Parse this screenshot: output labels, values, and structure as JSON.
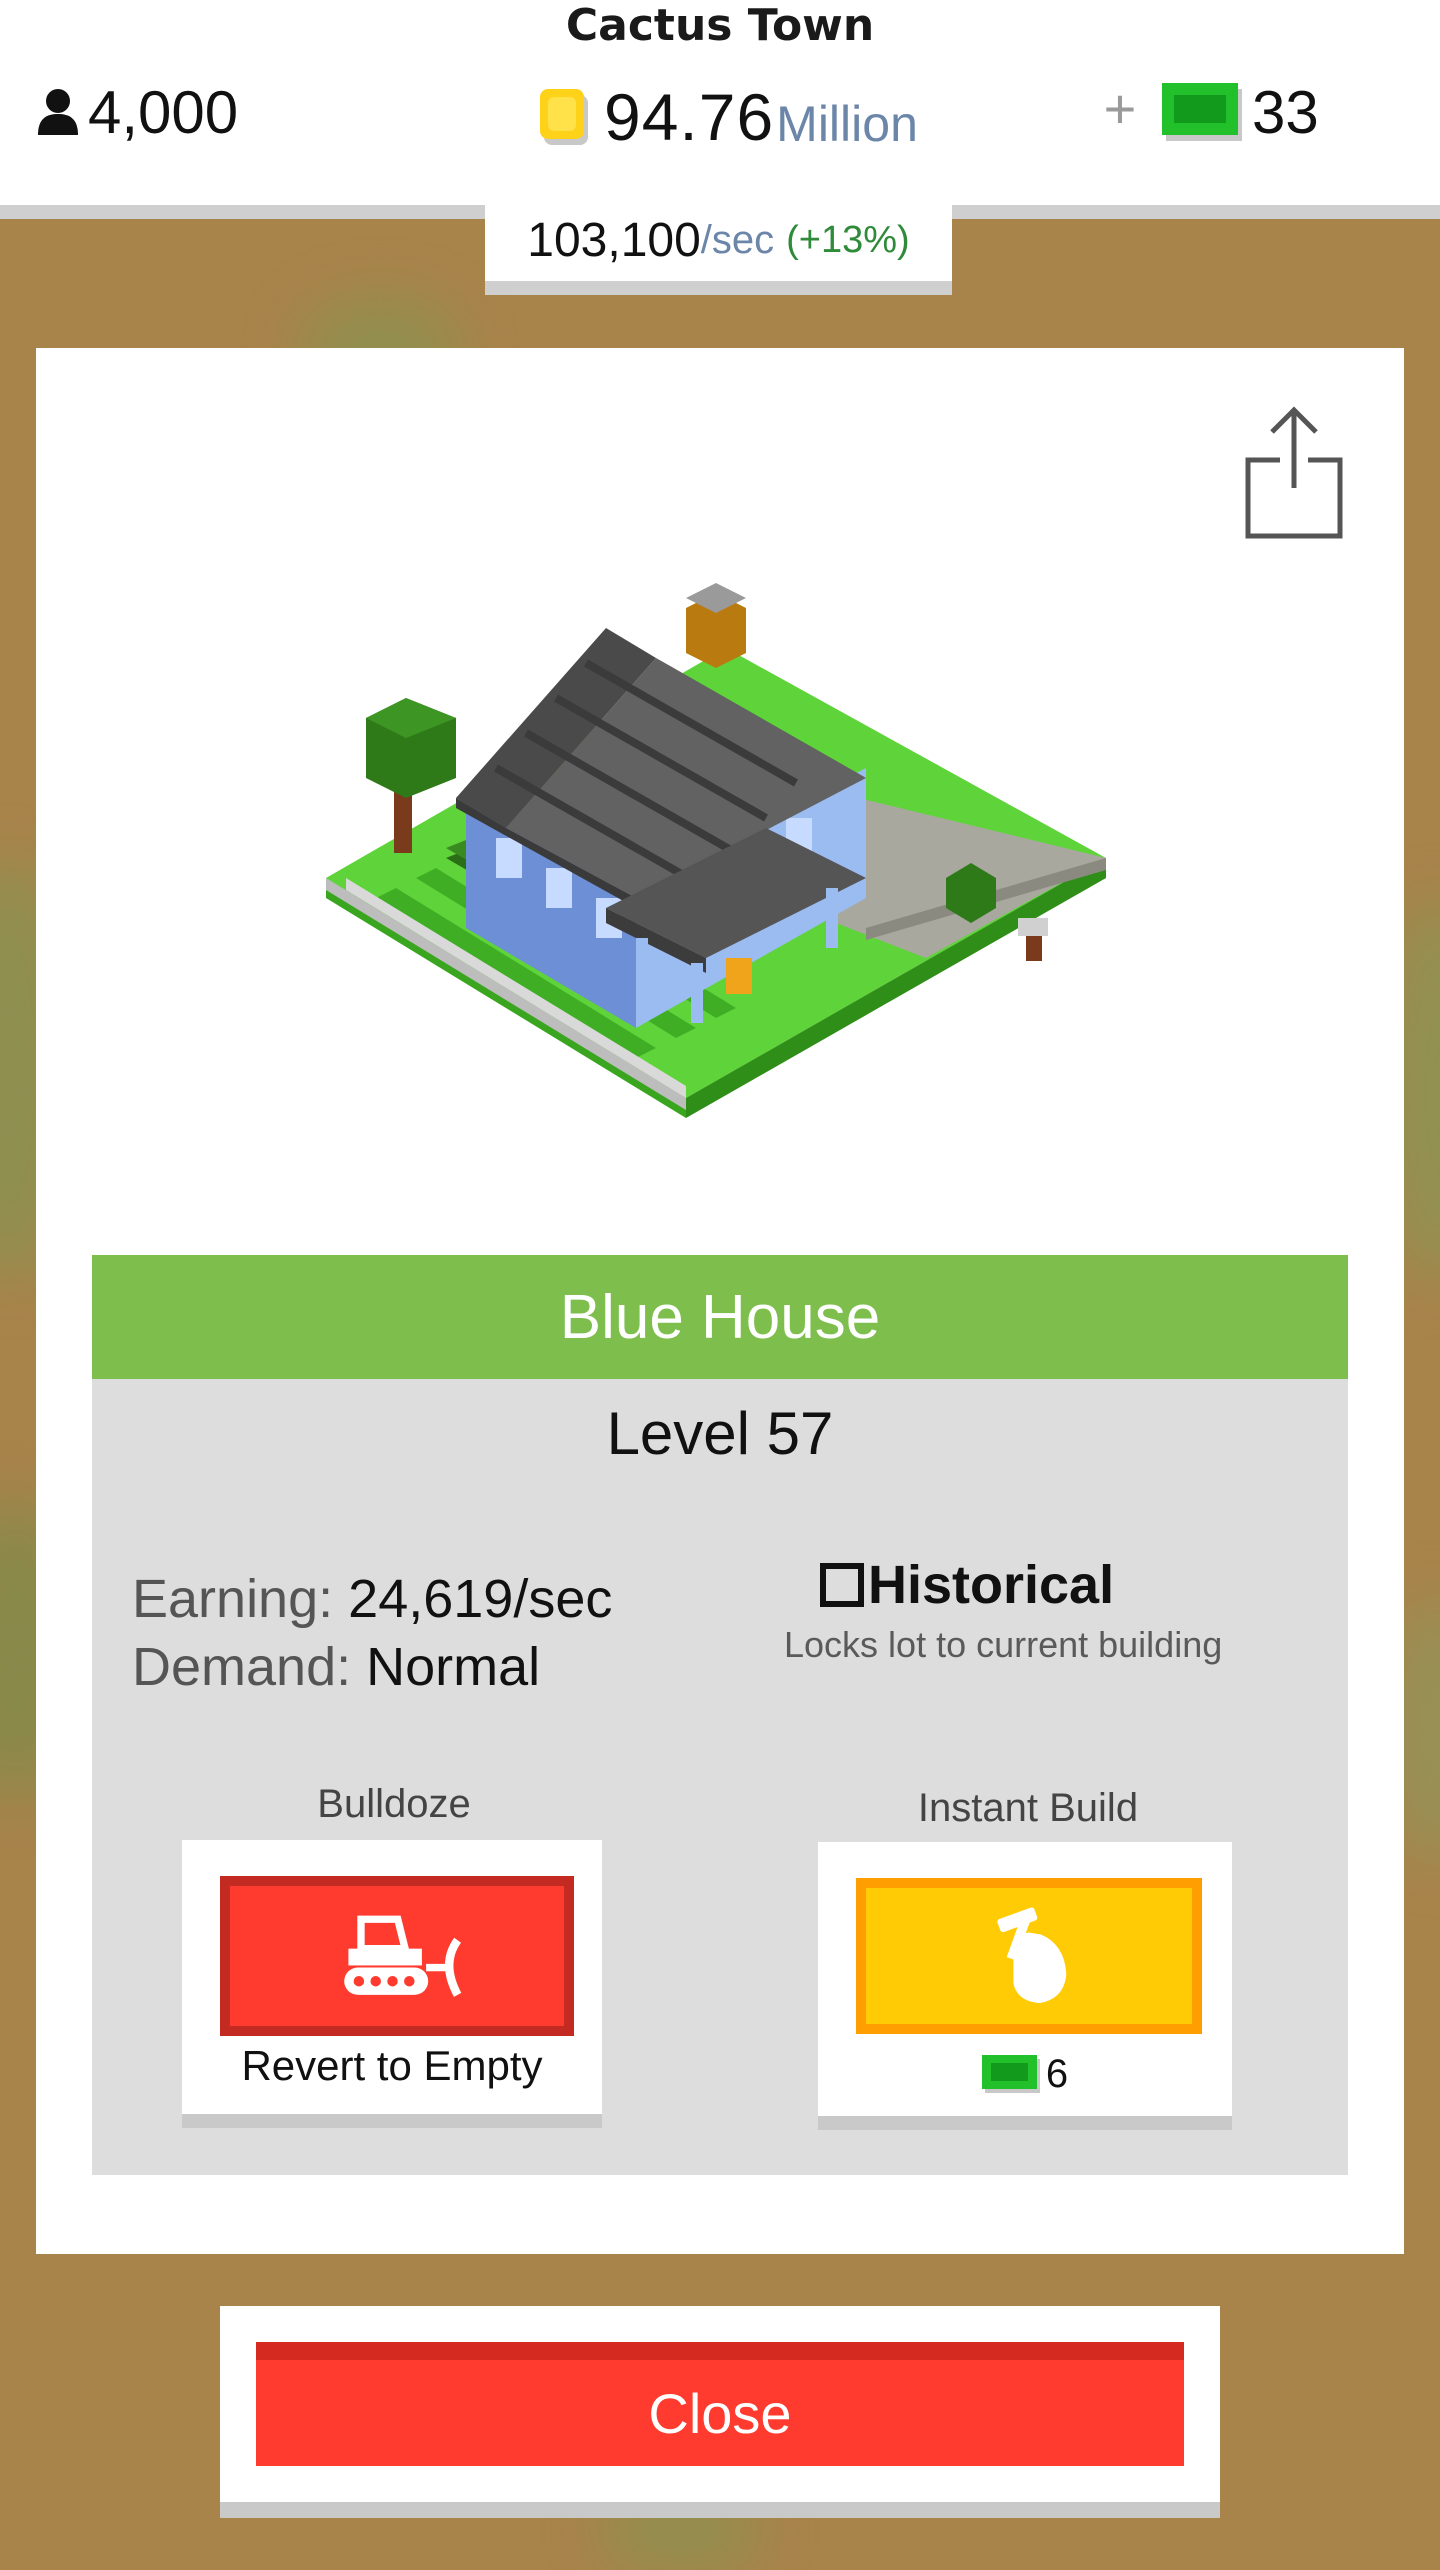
{
  "header": {
    "town_name": "Cactus Town",
    "population": "4,000",
    "money_value": "94.76",
    "money_unit": "Million",
    "cash": "33",
    "income_rate": "103,100",
    "income_unit": "/sec",
    "income_bonus": "(+13%)"
  },
  "building": {
    "name": "Blue House",
    "level": "Level 57",
    "earning_label": "Earning:",
    "earning_value": "24,619/sec",
    "demand_label": "Demand:",
    "demand_value": "Normal",
    "historical_label": "Historical",
    "historical_desc": "Locks lot to current building",
    "historical_checked": false
  },
  "actions": {
    "bulldoze_label": "Bulldoze",
    "bulldoze_button_text": "Revert to Empty",
    "instant_build_label": "Instant Build",
    "instant_build_cost": "6"
  },
  "footer": {
    "close_label": "Close"
  },
  "icons": {
    "population": "person-icon",
    "money": "coin-icon",
    "cash": "cash-icon",
    "share": "share-icon",
    "bulldoze": "bulldozer-icon",
    "instant_build": "hammer-hand-icon"
  },
  "colors": {
    "title_bar": "#7ebe4d",
    "bulldoze_button": "#ff3a2e",
    "instant_build_button": "#ffcb05",
    "close_button": "#ff3a2e",
    "cash_green": "#22c02a",
    "bonus_green": "#2f8a3a"
  }
}
